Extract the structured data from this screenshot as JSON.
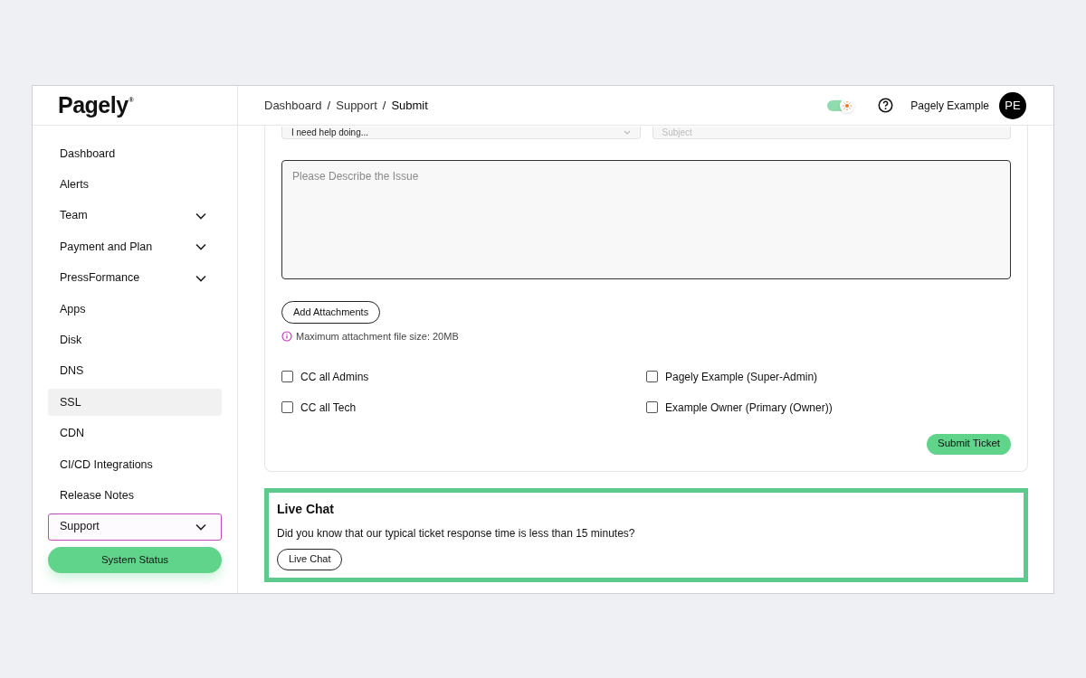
{
  "logo": {
    "text": "Pagely",
    "mark": "®"
  },
  "breadcrumb": [
    {
      "label": "Dashboard",
      "current": false
    },
    {
      "label": "Support",
      "current": false
    },
    {
      "label": "Submit",
      "current": true
    }
  ],
  "breadcrumb_separator": "/",
  "header": {
    "theme_toggle": {
      "on": true
    },
    "user_name": "Pagely Example",
    "avatar_initials": "PE"
  },
  "sidebar": {
    "items": [
      {
        "label": "Dashboard",
        "expandable": false,
        "selected": false,
        "hovered": false
      },
      {
        "label": "Alerts",
        "expandable": false,
        "selected": false,
        "hovered": false
      },
      {
        "label": "Team",
        "expandable": true,
        "selected": false,
        "hovered": false
      },
      {
        "label": "Payment and Plan",
        "expandable": true,
        "selected": false,
        "hovered": false
      },
      {
        "label": "PressFormance",
        "expandable": true,
        "selected": false,
        "hovered": false
      },
      {
        "label": "Apps",
        "expandable": false,
        "selected": false,
        "hovered": false
      },
      {
        "label": "Disk",
        "expandable": false,
        "selected": false,
        "hovered": false
      },
      {
        "label": "DNS",
        "expandable": false,
        "selected": false,
        "hovered": false
      },
      {
        "label": "SSL",
        "expandable": false,
        "selected": false,
        "hovered": true
      },
      {
        "label": "CDN",
        "expandable": false,
        "selected": false,
        "hovered": false
      },
      {
        "label": "CI/CD Integrations",
        "expandable": false,
        "selected": false,
        "hovered": false
      },
      {
        "label": "Release Notes",
        "expandable": false,
        "selected": false,
        "hovered": false
      },
      {
        "label": "Support",
        "expandable": true,
        "selected": true,
        "hovered": false
      }
    ],
    "status_button": "System Status"
  },
  "form": {
    "topic_select": {
      "value": "I need help doing..."
    },
    "subject": {
      "placeholder": "Subject"
    },
    "description": {
      "placeholder": "Please Describe the Issue"
    },
    "attach_button": "Add Attachments",
    "attach_note": "Maximum attachment file size: 20MB",
    "cc": [
      {
        "label": "CC all Admins",
        "checked": false
      },
      {
        "label": "Pagely Example (Super-Admin)",
        "checked": false
      },
      {
        "label": "CC all Tech",
        "checked": false
      },
      {
        "label": "Example Owner (Primary (Owner))",
        "checked": false
      }
    ],
    "submit_button": "Submit Ticket"
  },
  "live_chat": {
    "title": "Live Chat",
    "text": "Did you know that our typical ticket response time is less than 15 minutes?",
    "button": "Live Chat"
  }
}
